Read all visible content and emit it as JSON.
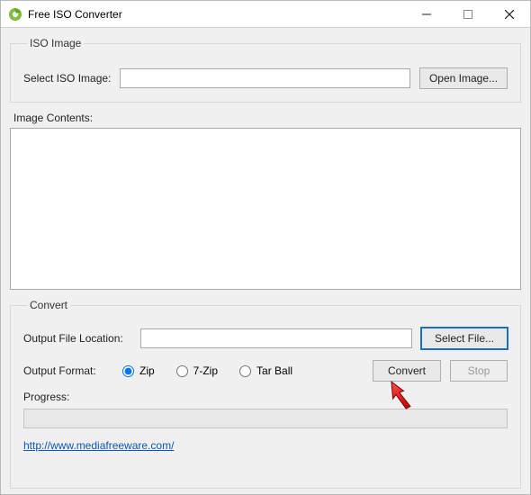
{
  "window": {
    "title": "Free ISO Converter"
  },
  "groups": {
    "iso_image": {
      "legend": "ISO Image",
      "select_label": "Select ISO Image:",
      "input_value": "",
      "open_btn": "Open Image..."
    },
    "image_contents": {
      "label": "Image Contents:"
    },
    "convert": {
      "legend": "Convert",
      "output_loc_label": "Output File Location:",
      "output_loc_value": "",
      "select_file_btn": "Select File...",
      "format_label": "Output Format:",
      "formats": {
        "zip": "Zip",
        "sevenzip": "7-Zip",
        "tarball": "Tar Ball"
      },
      "selected_format": "zip",
      "convert_btn": "Convert",
      "stop_btn": "Stop",
      "progress_label": "Progress:"
    }
  },
  "footer": {
    "link_text": "http://www.mediafreeware.com/",
    "link_href": "http://www.mediafreeware.com/"
  }
}
